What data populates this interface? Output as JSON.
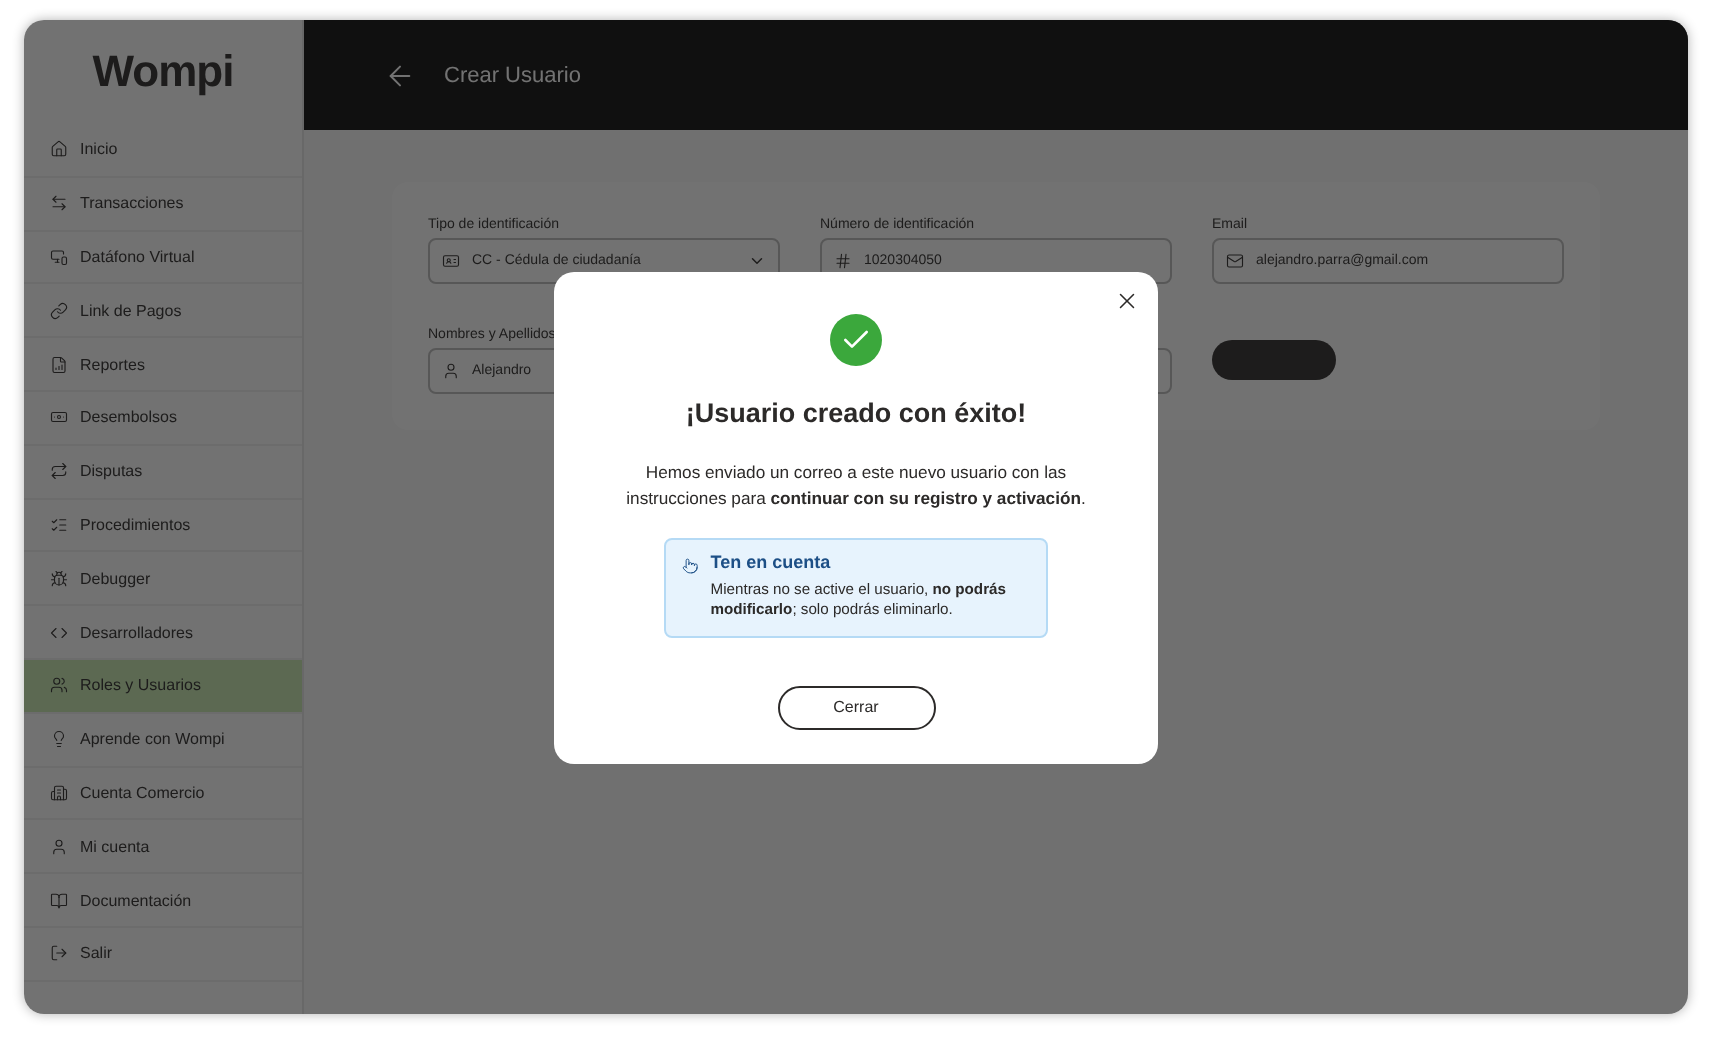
{
  "brand": {
    "logo": "Wompi"
  },
  "header": {
    "title": "Crear Usuario"
  },
  "sidebar": {
    "items": [
      {
        "label": "Inicio",
        "selected": false
      },
      {
        "label": "Transacciones",
        "selected": false
      },
      {
        "label": "Datáfono Virtual",
        "selected": false
      },
      {
        "label": "Link de Pagos",
        "selected": false
      },
      {
        "label": "Reportes",
        "selected": false
      },
      {
        "label": "Desembolsos",
        "selected": false
      },
      {
        "label": "Disputas",
        "selected": false
      },
      {
        "label": "Procedimientos",
        "selected": false
      },
      {
        "label": "Debugger",
        "selected": false
      },
      {
        "label": "Desarrolladores",
        "selected": false
      },
      {
        "label": "Roles y Usuarios",
        "selected": true
      },
      {
        "label": "Aprende con Wompi",
        "selected": false
      },
      {
        "label": "Cuenta Comercio",
        "selected": false
      },
      {
        "label": "Mi cuenta",
        "selected": false
      },
      {
        "label": "Documentación",
        "selected": false
      },
      {
        "label": "Salir",
        "selected": false
      }
    ]
  },
  "form": {
    "fields": [
      {
        "label": "Tipo de identificación",
        "value": "CC - Cédula de ciudadanía",
        "kind": "select"
      },
      {
        "label": "Número de identificación",
        "value": "1020304050",
        "kind": "text"
      },
      {
        "label": "Email",
        "value": "alejandro.parra@gmail.com",
        "kind": "text"
      },
      {
        "label": "Nombres y Apellidos",
        "value": "Alejandro",
        "kind": "wide"
      }
    ]
  },
  "modal": {
    "title": "¡Usuario creado con éxito!",
    "message": "Hemos enviado un correo a este nuevo usuario con las instrucciones para **continuar con su registro y activación**.",
    "notice": {
      "title": "Ten en cuenta",
      "text": "Mientras no se active el usuario, **no podrás modificarlo**; solo podrás eliminarlo."
    },
    "button": "Cerrar"
  }
}
